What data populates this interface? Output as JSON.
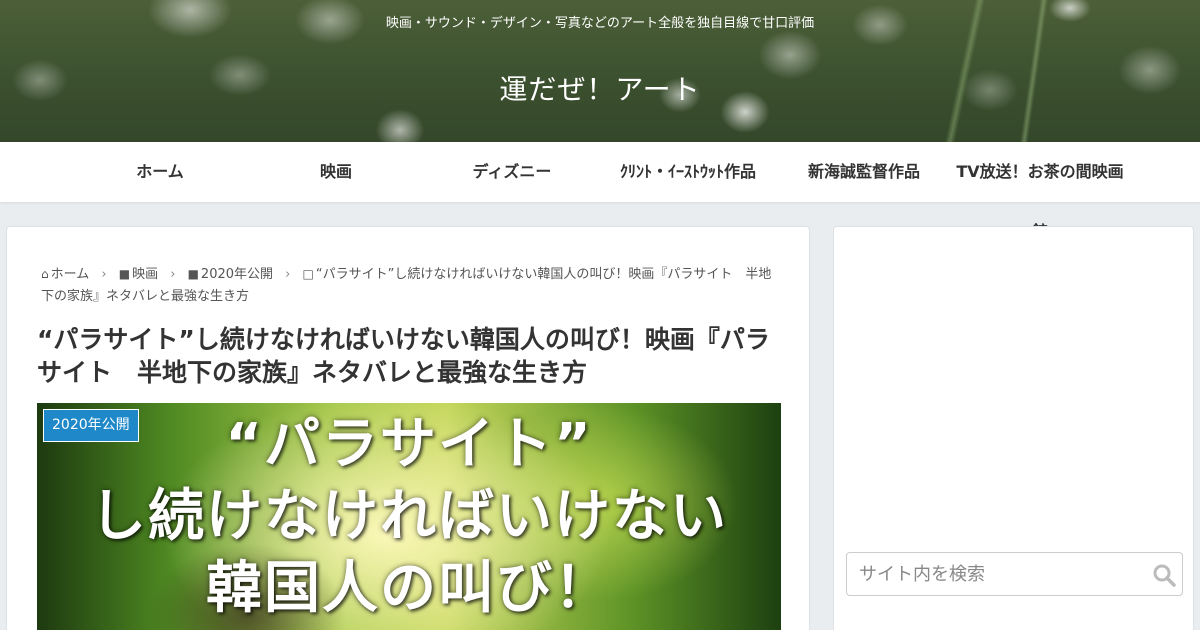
{
  "header": {
    "tagline": "映画・サウンド・デザイン・写真などのアート全般を独自目線で甘口評価",
    "site_title": "運だぜ！アート"
  },
  "nav": {
    "items": [
      {
        "label": "ホーム"
      },
      {
        "label": "映画"
      },
      {
        "label": "ディズニー"
      },
      {
        "label": "ｸﾘﾝﾄ・ｲｰｽﾄｳｯﾄ作品"
      },
      {
        "label": "新海誠監督作品"
      },
      {
        "label_line1": "TV放送！お茶の間映画",
        "label_line2": "館"
      }
    ]
  },
  "breadcrumb": {
    "home": "ホーム",
    "cat1": "映画",
    "cat2": "2020年公開",
    "current": "“パラサイト”し続けなければいけない韓国人の叫び！映画『パラサイト　半地下の家族』ネタバレと最強な生き方"
  },
  "post": {
    "title": "“パラサイト”し続けなければいけない韓国人の叫び！映画『パラサイト　半地下の家族』ネタバレと最強な生き方",
    "category_badge": "2020年公開",
    "eyecatch_line1": "“パラサイト”",
    "eyecatch_line2": "し続けなければいけない",
    "eyecatch_line3": "韓国人の叫び！"
  },
  "sidebar": {
    "search_placeholder": "サイト内を検索"
  },
  "colors": {
    "badge": "#1e88c8",
    "background": "#e9edf0"
  }
}
